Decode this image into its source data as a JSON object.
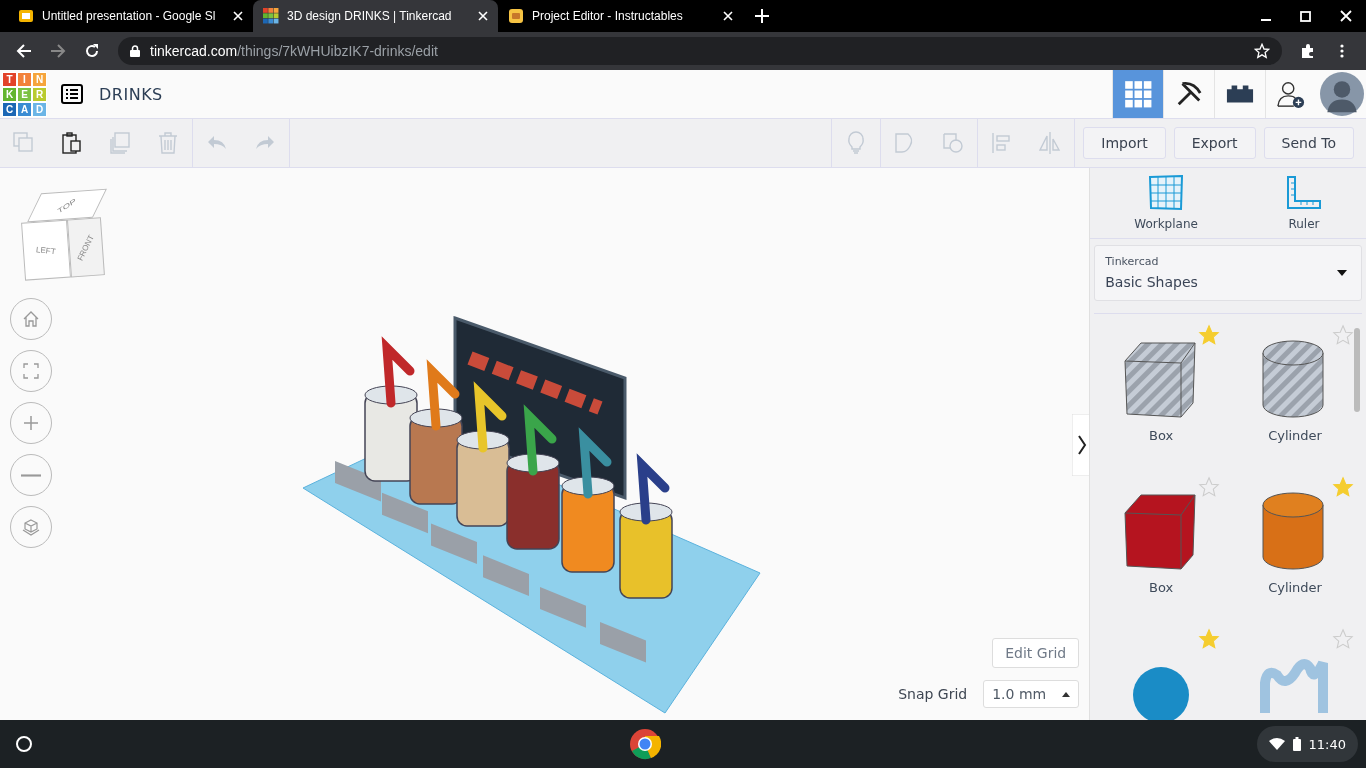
{
  "browser": {
    "tabs": [
      {
        "title": "Untitled presentation - Google Sl",
        "kind": "slides",
        "selected": false
      },
      {
        "title": "3D design DRINKS | Tinkercad",
        "kind": "tinkercad",
        "selected": true
      },
      {
        "title": "Project Editor - Instructables",
        "kind": "instructables",
        "selected": false
      }
    ],
    "address": {
      "host": "tinkercad.com",
      "path": "/things/7kWHUibzIK7-drinks/edit"
    }
  },
  "app": {
    "logo_letters": [
      "T",
      "I",
      "N",
      "K",
      "E",
      "R",
      "C",
      "A",
      "D"
    ],
    "design_name": "DRINKS",
    "views": [
      {
        "kind": "grid",
        "selected": true
      },
      {
        "kind": "pickaxe",
        "selected": false
      },
      {
        "kind": "brick",
        "selected": false
      }
    ],
    "toolbar": [
      {
        "kind": "copy",
        "disabled": true
      },
      {
        "kind": "paste",
        "disabled": false
      },
      {
        "kind": "duplicate",
        "disabled": true
      },
      {
        "kind": "delete",
        "disabled": true
      },
      {
        "kind": "undo",
        "disabled": true
      },
      {
        "kind": "redo",
        "disabled": true
      }
    ],
    "tools_right": [
      {
        "kind": "bulb",
        "disabled": true
      },
      {
        "kind": "shape",
        "disabled": true
      },
      {
        "kind": "hole",
        "disabled": true
      },
      {
        "kind": "align",
        "disabled": true
      },
      {
        "kind": "mirror",
        "disabled": true
      }
    ],
    "actions": [
      "Import",
      "Export",
      "Send To"
    ],
    "view_cube": {
      "top": "TOP",
      "left": "LEFT",
      "front": "FRONT"
    },
    "nav_controls": [
      {
        "kind": "home"
      },
      {
        "kind": "fit"
      },
      {
        "kind": "zoom-in"
      },
      {
        "kind": "zoom-out"
      },
      {
        "kind": "perspective"
      }
    ],
    "edit_grid": "Edit Grid",
    "snap_grid": {
      "label": "Snap Grid",
      "value": "1.0 mm"
    },
    "panel": {
      "tools": [
        {
          "kind": "workplane",
          "label": "Workplane"
        },
        {
          "kind": "ruler",
          "label": "Ruler"
        }
      ],
      "library": {
        "caption": "Tinkercad",
        "value": "Basic Shapes"
      },
      "shapes": [
        {
          "kind": "box-hole",
          "label": "Box",
          "favorite": true
        },
        {
          "kind": "cylinder-hole",
          "label": "Cylinder",
          "favorite": false
        },
        {
          "kind": "box",
          "label": "Box",
          "favorite": false
        },
        {
          "kind": "cylinder",
          "label": "Cylinder",
          "favorite": true
        },
        {
          "kind": "sphere",
          "favorite": true
        },
        {
          "kind": "scribble",
          "favorite": false
        }
      ]
    }
  },
  "taskbar": {
    "time": "11:40"
  }
}
